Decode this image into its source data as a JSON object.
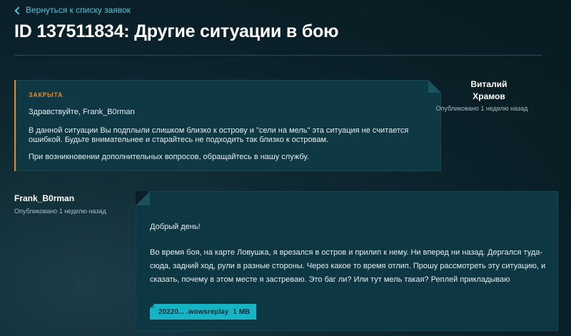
{
  "nav": {
    "back_label": "Вернуться к списку заявок"
  },
  "ticket": {
    "title": "ID 137511834: Другие ситуации в бою"
  },
  "support_reply": {
    "status": "ЗАКРЫТА",
    "greeting": "Здравствуйте, Frank_B0rman",
    "paragraph1": "В данной ситуации Вы подплыли слишком близко к острову и \"сели на мель\" эта ситуация не считается ошибкой. Будьте внимательнее и старайтесь не подходить так близко к островам.",
    "paragraph2": "При возникновении дополнительных вопросов, обращайтесь в нашу службу.",
    "author_line1": "Виталий",
    "author_line2": "Храмов",
    "published": "Опубликовано 1 неделю назад"
  },
  "user_message": {
    "author": "Frank_B0rman",
    "published": "Опубликовано 1 неделю назад",
    "greeting": "Добрый день!",
    "body": "Во время боя, на карте Ловушка, я врезался в остров и прилип к нему. Ни вперед ни назад. Дергался туда-сюда, задний ход, рули в разные стороны. Через какое то время отлип. Прошу рассмотреть эту ситуацию, и сказать, почему в этом месте я застреваю. Это баг ли? Или тут мель такая? Реплей прикладываю",
    "attachment_name": "20220... .wowsreplay",
    "attachment_size": "1 MB"
  },
  "colors": {
    "accent": "#4fc3d6",
    "status": "#e0882b",
    "attachment": "#17b3c7"
  }
}
